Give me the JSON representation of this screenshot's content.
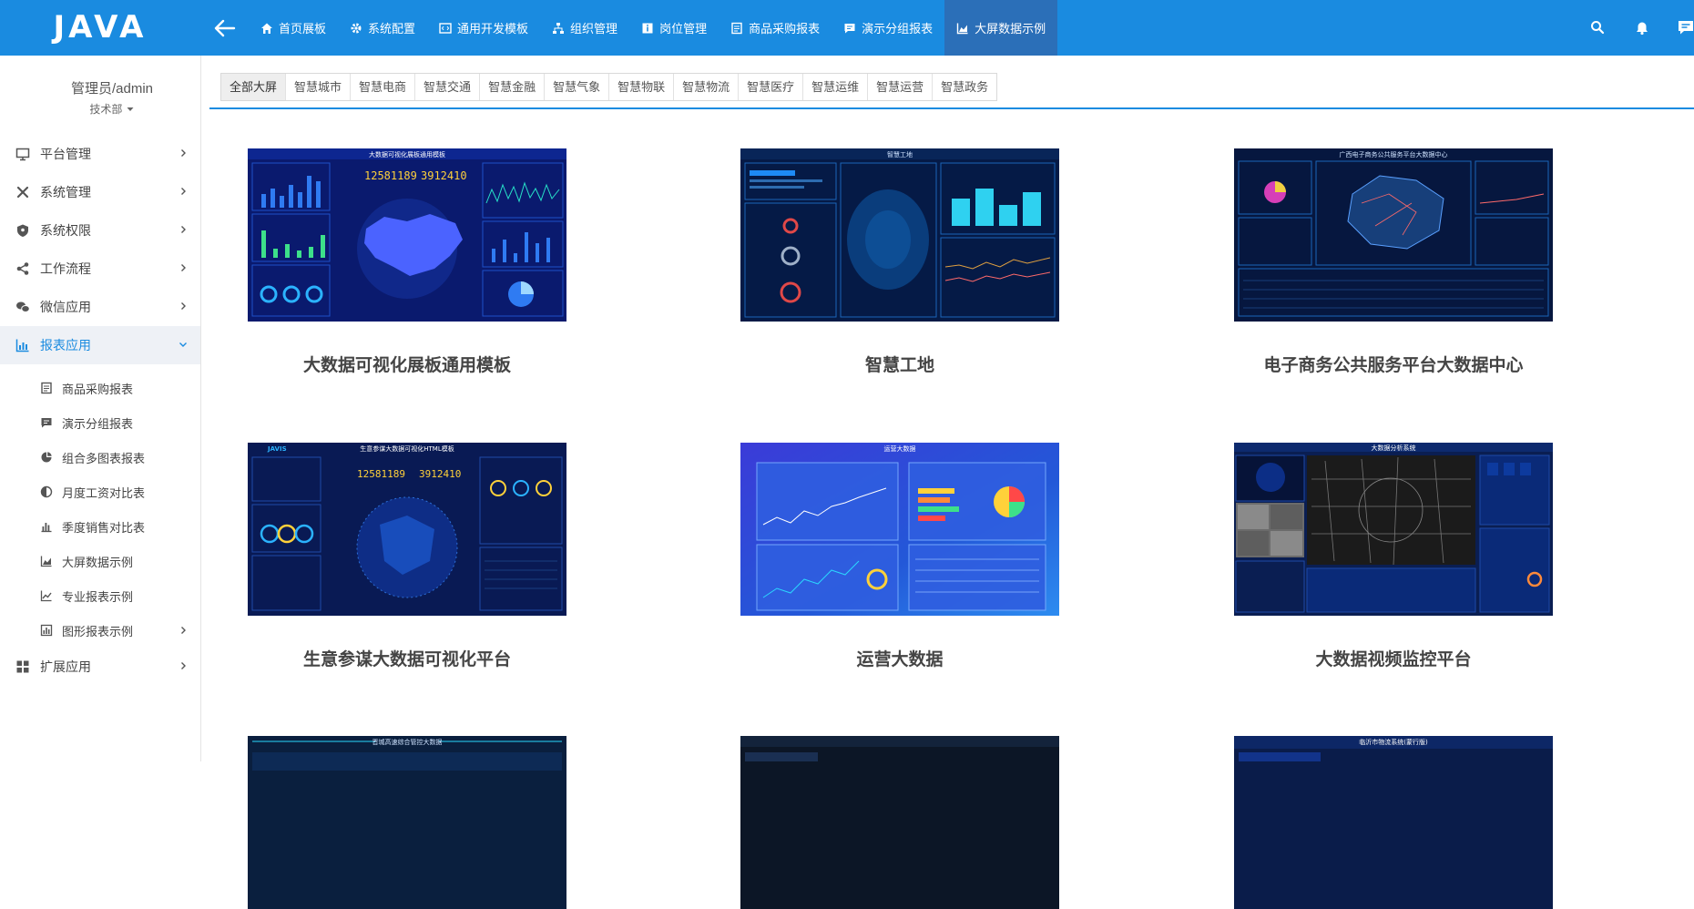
{
  "app": {
    "logo": "JAVA"
  },
  "nav": [
    {
      "label": "首页展板",
      "icon": "home-icon"
    },
    {
      "label": "系统配置",
      "icon": "gear-icon"
    },
    {
      "label": "通用开发模板",
      "icon": "code-icon"
    },
    {
      "label": "组织管理",
      "icon": "org-icon"
    },
    {
      "label": "岗位管理",
      "icon": "info-icon"
    },
    {
      "label": "商品采购报表",
      "icon": "list-icon"
    },
    {
      "label": "演示分组报表",
      "icon": "chat-icon"
    },
    {
      "label": "大屏数据示例",
      "icon": "area-chart-icon"
    }
  ],
  "user": {
    "name": "管理员/admin",
    "dept": "技术部"
  },
  "menu": {
    "platform": "平台管理",
    "system": "系统管理",
    "permission": "系统权限",
    "workflow": "工作流程",
    "wechat": "微信应用",
    "report": "报表应用",
    "extension": "扩展应用"
  },
  "submenu": {
    "purchase": "商品采购报表",
    "group": "演示分组报表",
    "combo": "组合多图表报表",
    "salary": "月度工资对比表",
    "season": "季度销售对比表",
    "screen": "大屏数据示例",
    "pro": "专业报表示例",
    "graphic": "图形报表示例"
  },
  "tabs": [
    "全部大屏",
    "智慧城市",
    "智慧电商",
    "智慧交通",
    "智慧金融",
    "智慧气象",
    "智慧物联",
    "智慧物流",
    "智慧医疗",
    "智慧运维",
    "智慧运营",
    "智慧政务"
  ],
  "cards": [
    {
      "title": "大数据可视化展板通用模板",
      "thumb_header": "大数据可视化展板通用模板",
      "num1": "12581189",
      "num2": "3912410"
    },
    {
      "title": "智慧工地",
      "thumb_header": "智慧工地"
    },
    {
      "title": "电子商务公共服务平台大数据中心",
      "thumb_header": "广西电子商务公共服务平台大数据中心"
    },
    {
      "title": "生意参谋大数据可视化平台",
      "thumb_header": "生意参谋大数据可视化HTML模板",
      "brand": "JAVIS",
      "num1": "12581189",
      "num2": "3912410"
    },
    {
      "title": "运营大数据",
      "thumb_header": "运营大数据"
    },
    {
      "title": "大数据视频监控平台",
      "thumb_header": "大数据分析系统"
    },
    {
      "thumb_header": "晋城高速综合管控大数据"
    },
    {
      "thumb_header": ""
    },
    {
      "thumb_header": "临沂市物流系统(蒙行版)"
    }
  ]
}
